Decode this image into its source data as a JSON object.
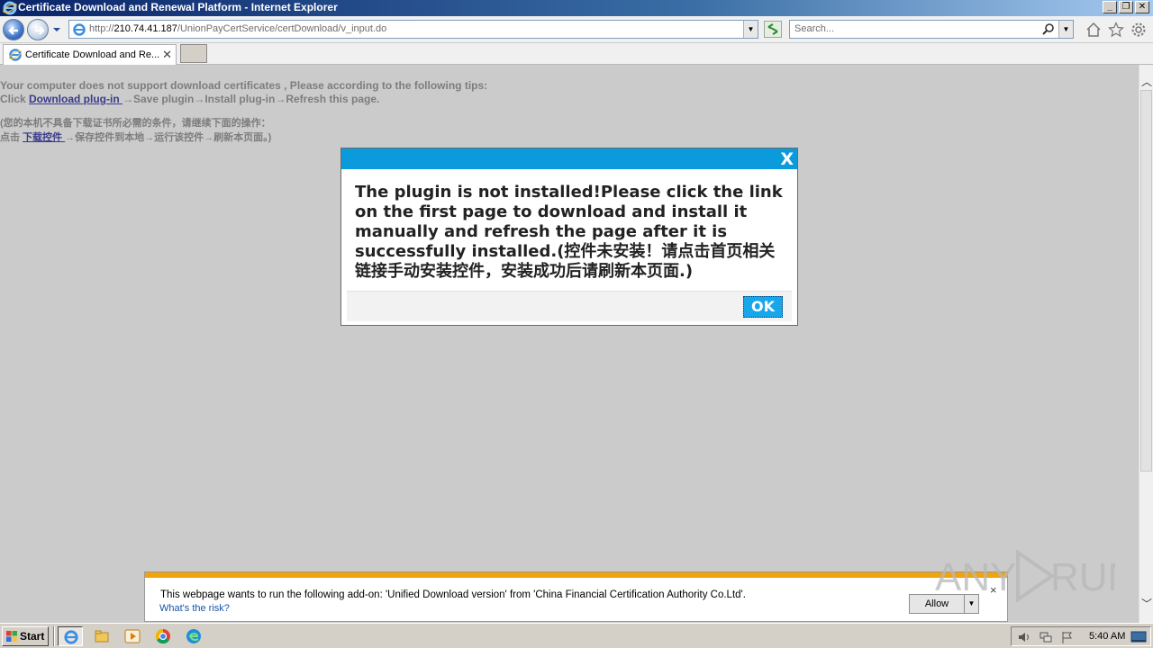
{
  "window": {
    "title": "Certificate Download and Renewal Platform - Internet Explorer"
  },
  "address_bar": {
    "url_scheme": "http://",
    "url_host": "210.74.41.187",
    "url_path": "/UnionPayCertService/certDownload/v_input.do"
  },
  "search": {
    "placeholder": "Search..."
  },
  "tabs": [
    {
      "label": "Certificate Download and Re...",
      "active": true
    }
  ],
  "page": {
    "tip_line1": "Your computer does not support download certificates , Please according to the following tips:",
    "tip_line2_prefix": "Click ",
    "tip_line2_link": "Download plug-in ",
    "tip_line2_suffix": "→Save plugin→Install plug-in→Refresh this page.",
    "cn_line1": "(您的本机不具备下载证书所必需的条件，请继续下面的操作：",
    "cn_line2_prefix": "点击 ",
    "cn_line2_link": "下载控件 ",
    "cn_line2_suffix": "→保存控件到本地→运行该控件→刷新本页面。)"
  },
  "dialog": {
    "close_label": "X",
    "message": "The plugin is not installed!Please click the link on the first page to download and install it manually and refresh the page after it is successfully installed.(控件未安装！请点击首页相关链接手动安装控件，安装成功后请刷新本页面.)",
    "ok_label": "OK",
    "header_color": "#0b9bdc"
  },
  "notification": {
    "message": "This webpage wants to run the following add-on: 'Unified Download version' from 'China Financial Certification Authority Co.Ltd'.",
    "risk_link": "What's the risk?",
    "allow_label": "Allow",
    "close_label": "×",
    "stripe_color": "#f0a30a"
  },
  "watermark": {
    "text": "ANY RUN"
  },
  "taskbar": {
    "start_label": "Start",
    "apps": [
      "ie-icon",
      "explorer-icon",
      "media-player-icon",
      "chrome-icon",
      "edge-icon"
    ],
    "clock": "5:40 AM"
  }
}
